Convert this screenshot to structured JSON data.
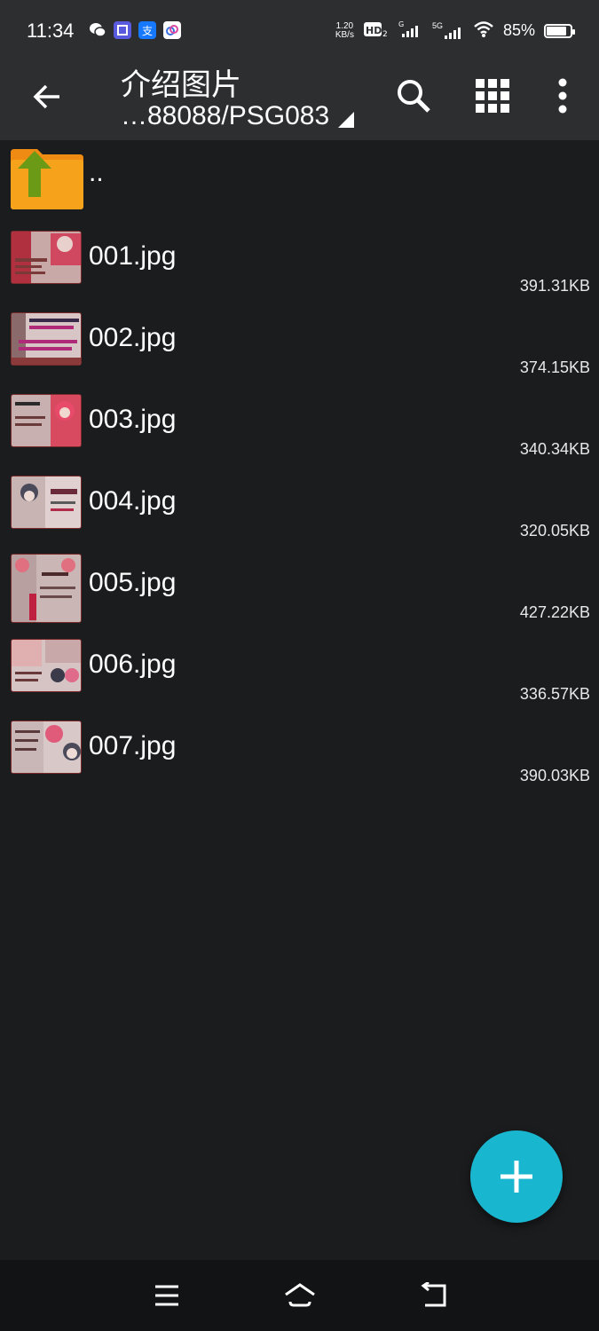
{
  "status_bar": {
    "time": "11:34",
    "speed_value": "1.20",
    "speed_unit": "KB/s",
    "network_5g": "5G",
    "battery_percent": "85%",
    "battery_level": 0.85,
    "app_icons": [
      "wechat-icon",
      "app-notification-icon",
      "alipay-icon",
      "app-cloud-icon"
    ],
    "app_icon_text": [
      "",
      "",
      "支",
      ""
    ]
  },
  "toolbar": {
    "title": "介绍图片",
    "path": "…88088/PSG083",
    "colors": {
      "background": "#2d2e30",
      "text": "#ffffff"
    }
  },
  "parent_dir": {
    "label": ".."
  },
  "files": [
    {
      "name": "001.jpg",
      "size": "391.31KB"
    },
    {
      "name": "002.jpg",
      "size": "374.15KB"
    },
    {
      "name": "003.jpg",
      "size": "340.34KB"
    },
    {
      "name": "004.jpg",
      "size": "320.05KB"
    },
    {
      "name": "005.jpg",
      "size": "427.22KB"
    },
    {
      "name": "006.jpg",
      "size": "336.57KB"
    },
    {
      "name": "007.jpg",
      "size": "390.03KB"
    }
  ],
  "fab": {
    "icon": "plus-icon",
    "color": "#19b6d0"
  },
  "nav_bar": {
    "buttons": [
      "menu-icon",
      "home-icon",
      "back-icon"
    ]
  }
}
